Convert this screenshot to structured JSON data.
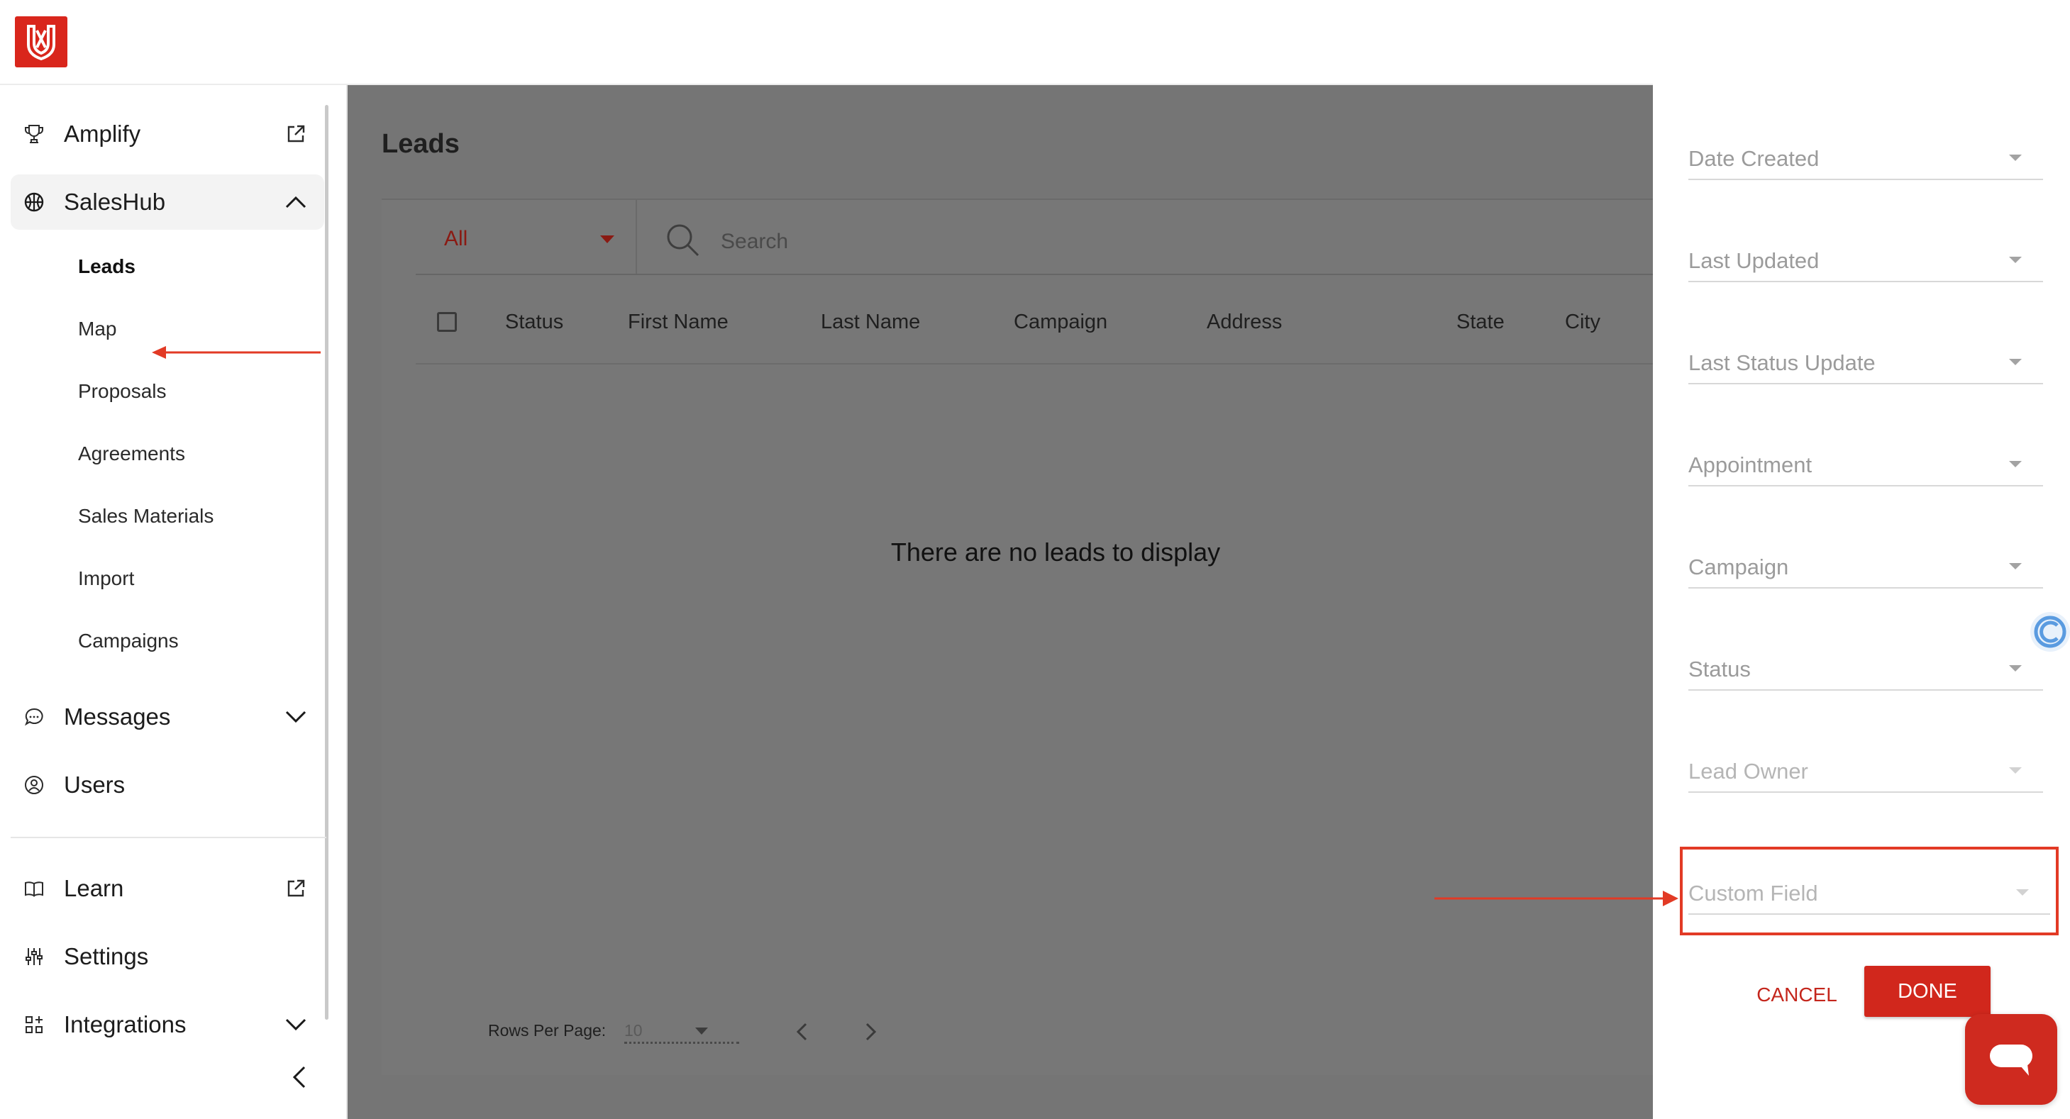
{
  "colors": {
    "brand_red": "#d1271c",
    "annotation_red": "#e23a25",
    "overlay": "#757575"
  },
  "sidebar": {
    "items": [
      {
        "label": "Amplify",
        "icon": "trophy-icon",
        "trail": "external-link-icon"
      },
      {
        "label": "SalesHub",
        "icon": "basketball-icon",
        "trail": "chevron-up-icon"
      },
      {
        "label": "Messages",
        "icon": "chat-bubble-icon",
        "trail": "chevron-down-icon"
      },
      {
        "label": "Users",
        "icon": "user-circle-icon"
      },
      {
        "label": "Learn",
        "icon": "book-icon",
        "trail": "external-link-icon"
      },
      {
        "label": "Settings",
        "icon": "sliders-icon"
      },
      {
        "label": "Integrations",
        "icon": "grid-icon",
        "trail": "chevron-down-icon"
      }
    ],
    "subitems": [
      "Leads",
      "Map",
      "Proposals",
      "Agreements",
      "Sales Materials",
      "Import",
      "Campaigns"
    ]
  },
  "main": {
    "title": "Leads",
    "filter": {
      "selected": "All"
    },
    "search": {
      "placeholder": "Search"
    },
    "columns": [
      "Status",
      "First Name",
      "Last Name",
      "Campaign",
      "Address",
      "State",
      "City"
    ],
    "empty_message": "There are no leads to display",
    "pagination": {
      "rows_label": "Rows Per Page:",
      "rows_value": "10"
    }
  },
  "panel": {
    "fields": [
      "Date Created",
      "Last Updated",
      "Last Status Update",
      "Appointment",
      "Campaign",
      "Status",
      "Lead Owner",
      "Custom Field"
    ],
    "cancel": "CANCEL",
    "done": "DONE"
  }
}
